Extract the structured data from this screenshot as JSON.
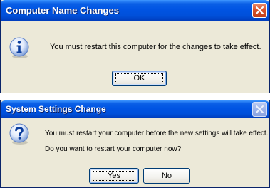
{
  "dialog1": {
    "title": "Computer Name Changes",
    "icon": "info-icon",
    "message": "You must restart this computer for the changes to take effect.",
    "ok_label": "OK",
    "close_icon": "close-icon"
  },
  "dialog2": {
    "title": "System Settings Change",
    "icon": "question-icon",
    "message_line1": "You must restart your computer before the new settings will take effect.",
    "message_line2": "Do you want to restart your computer now?",
    "yes_accel": "Y",
    "yes_rest": "es",
    "no_accel": "N",
    "no_rest": "o",
    "close_icon": "close-icon"
  },
  "colors": {
    "titlebar_blue": "#0054e3",
    "dialog_body": "#ece9d8",
    "close_red": "#d9532c"
  }
}
